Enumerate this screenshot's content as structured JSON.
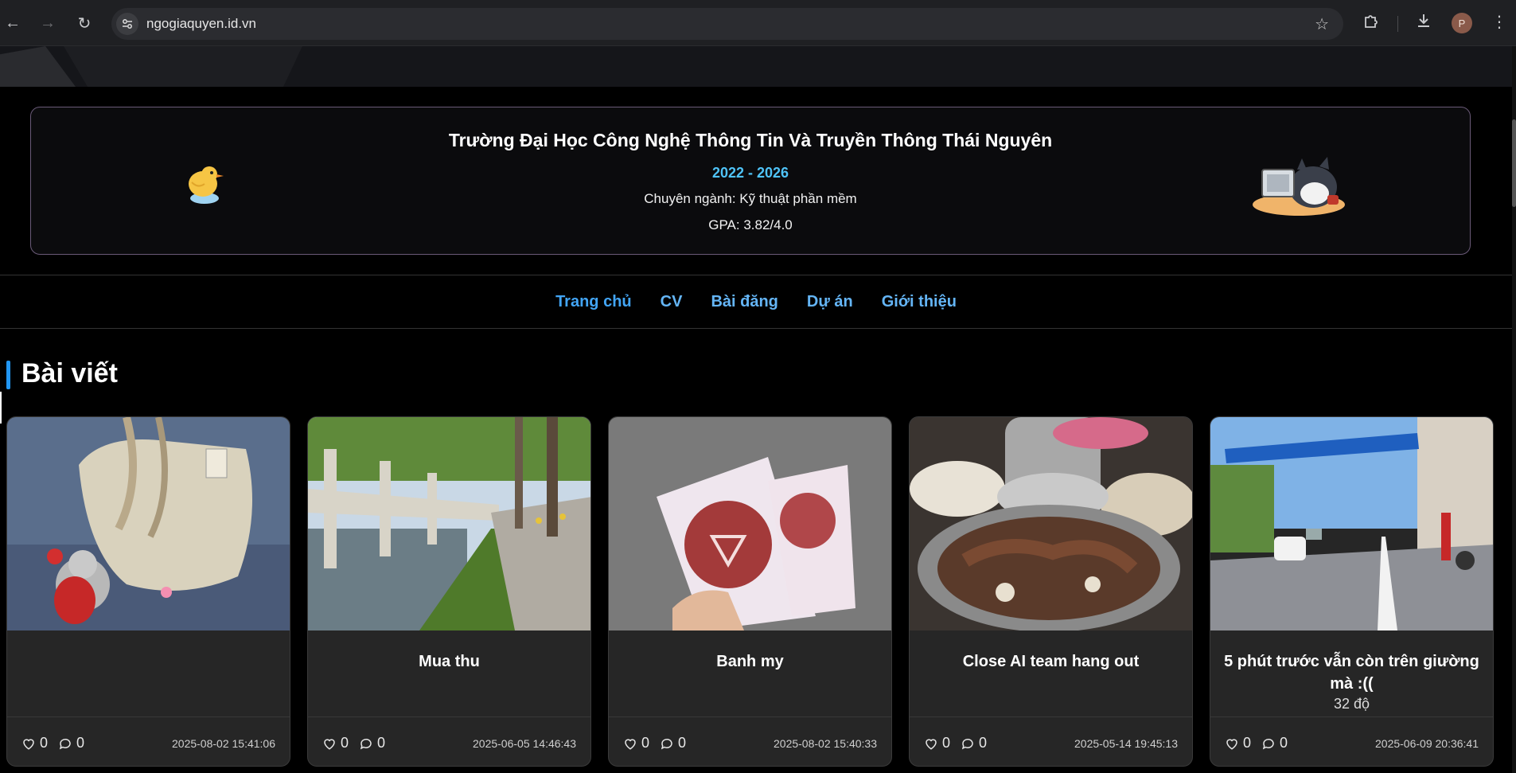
{
  "browser": {
    "url": "ngogiaquyen.id.vn",
    "avatar_initial": "P"
  },
  "education": {
    "school": "Trường Đại Học Công Nghệ Thông Tin Và Truyền Thông Thái Nguyên",
    "years": "2022 - 2026",
    "major": "Chuyên ngành: Kỹ thuật phần mềm",
    "gpa": "GPA: 3.82/4.0"
  },
  "nav": {
    "items": [
      {
        "label": "Trang chủ",
        "active": true
      },
      {
        "label": "CV"
      },
      {
        "label": "Bài đăng"
      },
      {
        "label": "Dự án"
      },
      {
        "label": "Giới thiệu"
      }
    ]
  },
  "section": {
    "title": "Bài viết"
  },
  "posts": [
    {
      "title": "",
      "subtitle": "",
      "likes": "0",
      "comments": "0",
      "date": "2025-08-02 15:41:06",
      "image": "bag-keychain-photo"
    },
    {
      "title": "Mua thu",
      "subtitle": "",
      "likes": "0",
      "comments": "0",
      "date": "2025-06-05 14:46:43",
      "image": "riverside-railing-photo"
    },
    {
      "title": "Banh my",
      "subtitle": "",
      "likes": "0",
      "comments": "0",
      "date": "2025-08-02 15:40:33",
      "image": "bread-bags-photo"
    },
    {
      "title": "Close AI team hang out",
      "subtitle": "",
      "likes": "0",
      "comments": "0",
      "date": "2025-05-14 19:45:13",
      "image": "bbq-grill-photo"
    },
    {
      "title": "5 phút trước vẫn còn trên giường mà :((",
      "subtitle": "32 độ",
      "likes": "0",
      "comments": "0",
      "date": "2025-06-09 20:36:41",
      "image": "city-street-photo"
    }
  ],
  "colors": {
    "accent": "#42a5f5",
    "years": "#4fc3f7",
    "card_bg": "#262626"
  }
}
